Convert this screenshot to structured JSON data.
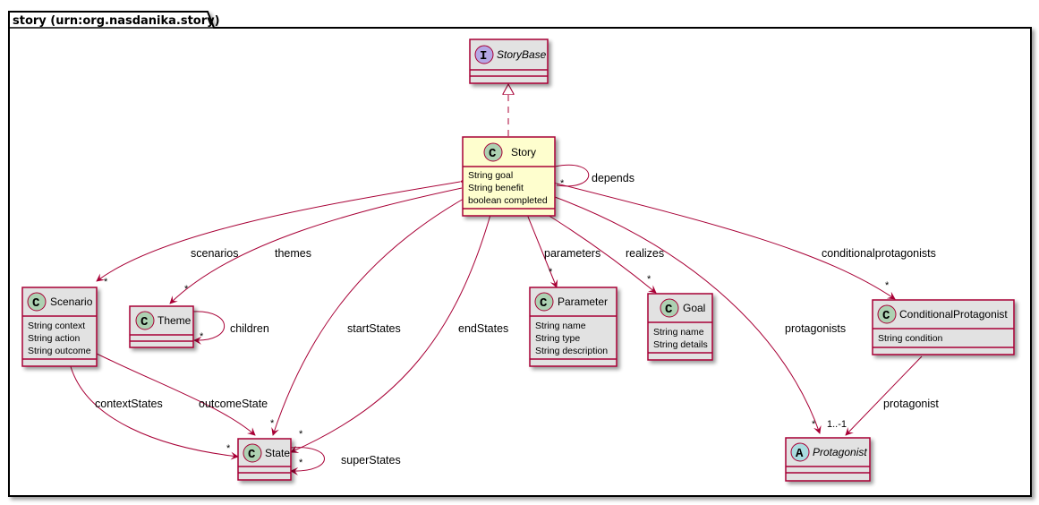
{
  "package": {
    "title": "story (urn:org.nasdanika.story)"
  },
  "colors": {
    "border": "#A80036",
    "class_fill": "#E2E2E2",
    "highlight_fill": "#FEFECE",
    "class_badge": "#ADD1B2",
    "interface_badge": "#B4A7E5",
    "abstract_badge": "#A9DCDF"
  },
  "classes": {
    "storybase": {
      "name": "StoryBase",
      "stereotype": "I",
      "attributes": []
    },
    "story": {
      "name": "Story",
      "stereotype": "C",
      "attributes": [
        "String goal",
        "String benefit",
        "boolean completed"
      ]
    },
    "scenario": {
      "name": "Scenario",
      "stereotype": "C",
      "attributes": [
        "String context",
        "String action",
        "String outcome"
      ]
    },
    "theme": {
      "name": "Theme",
      "stereotype": "C",
      "attributes": []
    },
    "parameter": {
      "name": "Parameter",
      "stereotype": "C",
      "attributes": [
        "String name",
        "String type",
        "String description"
      ]
    },
    "goal": {
      "name": "Goal",
      "stereotype": "C",
      "attributes": [
        "String name",
        "String details"
      ]
    },
    "conditionalprotagonist": {
      "name": "ConditionalProtagonist",
      "stereotype": "C",
      "attributes": [
        "String condition"
      ]
    },
    "state": {
      "name": "State",
      "stereotype": "C",
      "attributes": []
    },
    "protagonist": {
      "name": "Protagonist",
      "stereotype": "A",
      "attributes": []
    }
  },
  "relations": {
    "depends": {
      "label": "depends",
      "target_mult": "*"
    },
    "scenarios": {
      "label": "scenarios",
      "target_mult": "*"
    },
    "themes": {
      "label": "themes",
      "target_mult": "*"
    },
    "children": {
      "label": "children",
      "target_mult": "*"
    },
    "startStates": {
      "label": "startStates",
      "target_mult": "*"
    },
    "endStates": {
      "label": "endStates",
      "target_mult": "*"
    },
    "parameters": {
      "label": "parameters",
      "target_mult": "*"
    },
    "realizes": {
      "label": "realizes",
      "target_mult": "*"
    },
    "protagonists": {
      "label": "protagonists",
      "target_mult": "*"
    },
    "conditionalprotagonists": {
      "label": "conditionalprotagonists",
      "target_mult": "*"
    },
    "protagonist": {
      "label": "protagonist",
      "target_mult": "1..-1"
    },
    "contextStates": {
      "label": "contextStates",
      "target_mult": "*"
    },
    "outcomeState": {
      "label": "outcomeState",
      "target_mult": "*"
    },
    "superStates": {
      "label": "superStates",
      "target_mult": "*"
    }
  }
}
